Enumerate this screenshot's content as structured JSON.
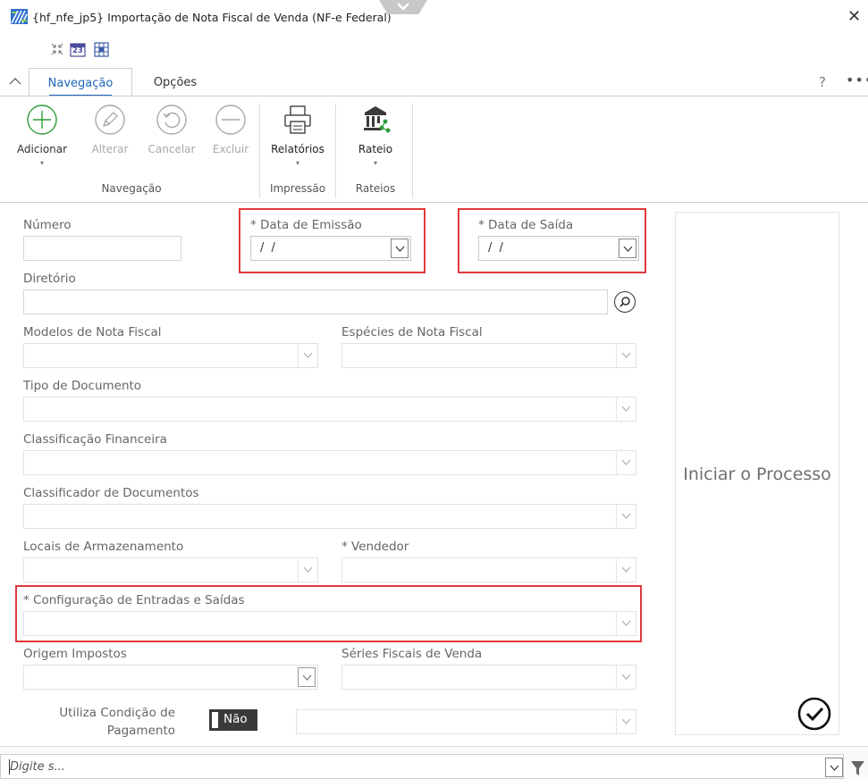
{
  "window": {
    "title": "{hf_nfe_jp5}  Importação de Nota Fiscal de Venda (NF-e Federal)",
    "close_glyph": "✕",
    "icons": [
      "app-logo-icon",
      "collapse-icon",
      "calendar-icon",
      "grid-icon"
    ]
  },
  "quick_toolbar": {
    "calendar_day": "23"
  },
  "tabs": [
    {
      "label": "Navegação",
      "active": true
    },
    {
      "label": "Opções",
      "active": false
    }
  ],
  "tab_actions": {
    "help": "?",
    "more": "•••"
  },
  "ribbon": {
    "groups": [
      {
        "label": "Navegação"
      },
      {
        "label": "Impressão"
      },
      {
        "label": "Rateios"
      }
    ],
    "buttons": {
      "adicionar": "Adicionar",
      "alterar": "Alterar",
      "cancelar": "Cancelar",
      "excluir": "Excluir",
      "relatorios": "Relatórios",
      "rateio": "Rateio"
    }
  },
  "form": {
    "numero": {
      "label": "Número",
      "value": ""
    },
    "data_emissao": {
      "label": "* Data de Emissão",
      "value": "/ /"
    },
    "data_saida": {
      "label": "* Data de Saída",
      "value": "/ /"
    },
    "diretorio": {
      "label": "Diretório",
      "value": ""
    },
    "modelos_nota_fiscal": {
      "label": "Modelos de Nota Fiscal",
      "value": ""
    },
    "especies_nota_fiscal": {
      "label": "Espécies de Nota Fiscal",
      "value": ""
    },
    "tipo_documento": {
      "label": "Tipo de Documento",
      "value": ""
    },
    "classificacao_financeira": {
      "label": "Classificação Financeira",
      "value": ""
    },
    "classificador_documentos": {
      "label": "Classificador de Documentos",
      "value": ""
    },
    "locais_armazenamento": {
      "label": "Locais de Armazenamento",
      "value": ""
    },
    "vendedor": {
      "label": "* Vendedor",
      "value": ""
    },
    "configuracao_entradas_saidas": {
      "label": "* Configuração de Entradas e Saídas",
      "value": ""
    },
    "origem_impostos": {
      "label": "Origem Impostos",
      "value": ""
    },
    "series_fiscais_venda": {
      "label": "Séries Fiscais de Venda",
      "value": ""
    },
    "utiliza_condicao": {
      "label_line1": "Utiliza Condição de",
      "label_line2": "Pagamento",
      "toggle_value": "Não"
    }
  },
  "side_panel": {
    "action_text": "Iniciar o Processo"
  },
  "filter_bar": {
    "placeholder": "Digite s..."
  },
  "colors": {
    "accent": "#1c66b9",
    "highlight": "#e03a3e",
    "add_green": "#2e9b3a",
    "toggle_bg": "#3a3a3a"
  }
}
